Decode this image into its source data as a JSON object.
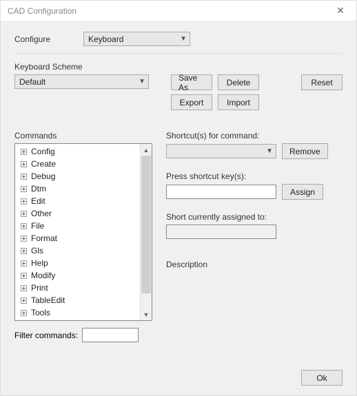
{
  "window": {
    "title": "CAD Configuration"
  },
  "configure": {
    "label": "Configure",
    "value": "Keyboard"
  },
  "scheme": {
    "label": "Keyboard Scheme",
    "value": "Default"
  },
  "buttons": {
    "save_as": "Save As",
    "delete": "Delete",
    "export": "Export",
    "import": "Import",
    "reset": "Reset",
    "remove": "Remove",
    "assign": "Assign",
    "ok": "Ok"
  },
  "commands": {
    "label": "Commands",
    "items": [
      "Config",
      "Create",
      "Debug",
      "Dtm",
      "Edit",
      "Other",
      "File",
      "Format",
      "Gls",
      "Help",
      "Modify",
      "Print",
      "TableEdit",
      "Tools"
    ],
    "filter_label": "Filter commands:",
    "filter_value": ""
  },
  "right": {
    "shortcuts_label": "Shortcut(s) for command:",
    "shortcuts_value": "",
    "press_label": "Press shortcut key(s):",
    "press_value": "",
    "assigned_label": "Short currently assigned to:",
    "assigned_value": "",
    "description_label": "Description"
  }
}
